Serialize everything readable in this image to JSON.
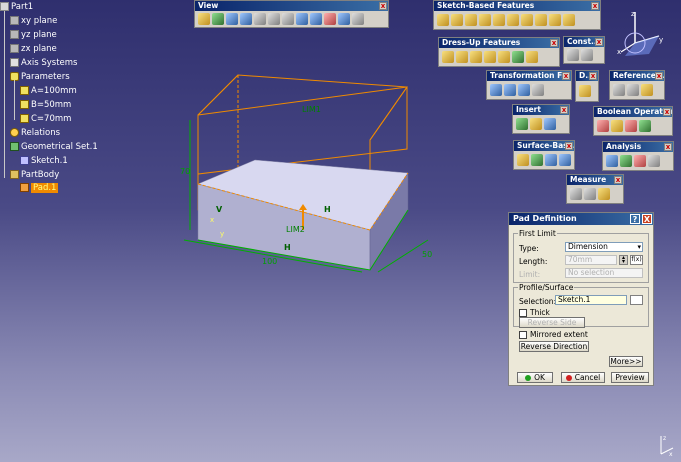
{
  "tree": {
    "root": "Part1",
    "xy": "xy plane",
    "yz": "yz plane",
    "zx": "zx plane",
    "axis": "Axis Systems",
    "params": "Parameters",
    "a": "A=100mm",
    "b": "B=50mm",
    "c": "C=70mm",
    "relations": "Relations",
    "geoset": "Geometrical Set.1",
    "sketch": "Sketch.1",
    "body": "PartBody",
    "pad": "Pad.1"
  },
  "toolbars": {
    "view": "View",
    "sketch_based": "Sketch-Based Features",
    "constraints": "Const...",
    "dressup": "Dress-Up Features",
    "transformation": "Transformation F...",
    "d": "D...",
    "reference": "Reference...",
    "insert": "Insert",
    "boolean": "Boolean Operations",
    "surface": "Surface-Base...",
    "analysis": "Analysis",
    "measure": "Measure",
    "close": "x"
  },
  "model": {
    "lim1": "LIM1",
    "lim2": "LIM2",
    "dim_len": "100",
    "dim_wid": "50",
    "dim_h": "70",
    "axis_x": "x",
    "axis_y": "y",
    "axis_z": "z"
  },
  "dialog": {
    "title": "Pad Definition",
    "help": "?",
    "close": "X",
    "first_limit": "First Limit",
    "type_label": "Type:",
    "type_value": "Dimension",
    "length_label": "Length:",
    "length_value": "70mm",
    "limit_label": "Limit:",
    "limit_value": "No selection",
    "profile_group": "Profile/Surface",
    "selection_label": "Selection:",
    "selection_value": "Sketch.1",
    "thick_label": "Thick",
    "reverse_side": "Reverse Side",
    "mirrored_label": "Mirrored extent",
    "reverse_direction": "Reverse Direction",
    "more": "More>>",
    "ok": "OK",
    "cancel": "Cancel",
    "preview": "Preview"
  },
  "colors": {
    "edge_orange": "#f08a00",
    "face_light": "#d8d8f0",
    "face_mid": "#b0b0d0",
    "face_dark": "#7a7aa8",
    "green": "#00b000"
  }
}
